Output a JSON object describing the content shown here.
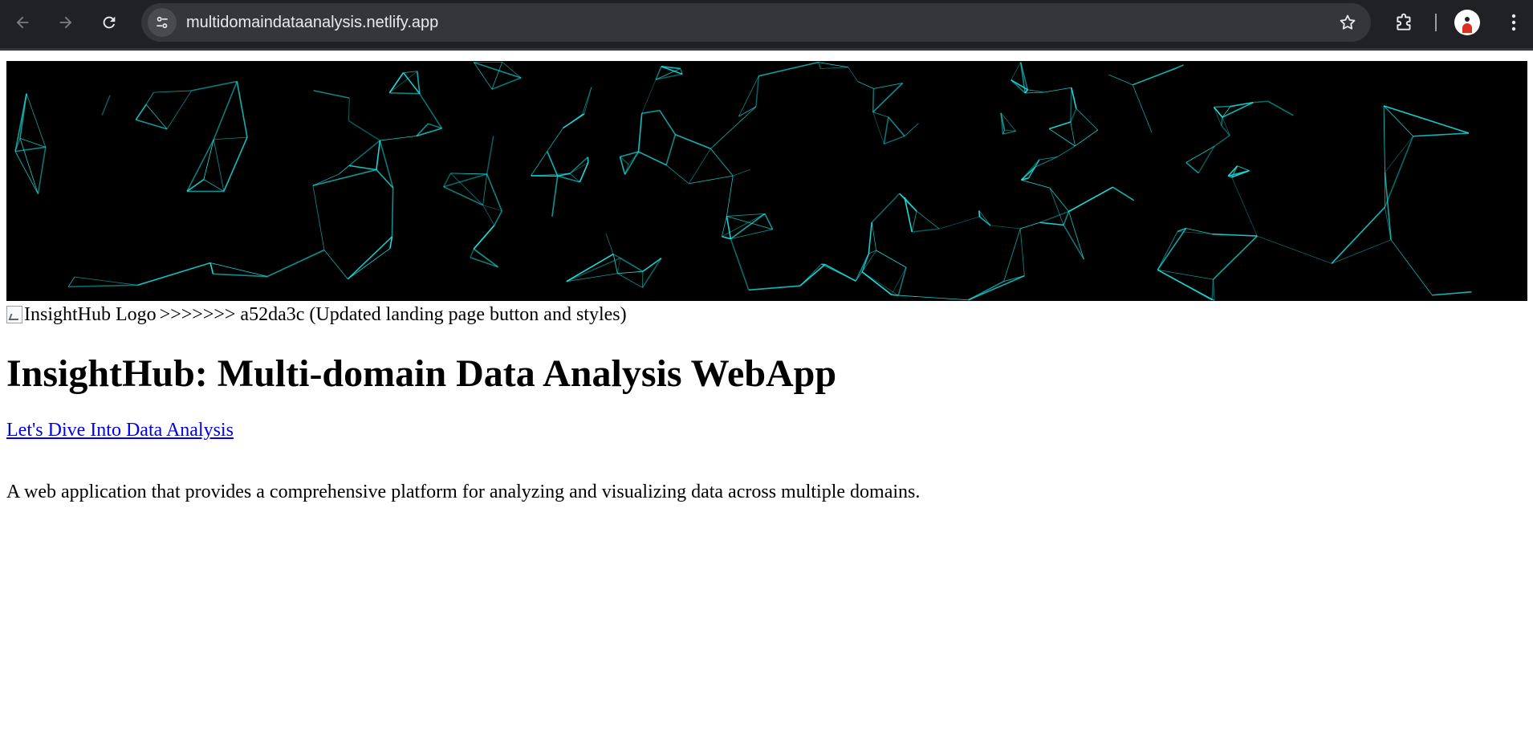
{
  "browser": {
    "url": "multidomaindataanalysis.netlify.app"
  },
  "page": {
    "logo_alt": "InsightHub Logo",
    "logo_line_text": ">>>>>>> a52da3c (Updated landing page button and styles)",
    "title": "InsightHub: Multi-domain Data Analysis WebApp",
    "cta_link": "Let's Dive Into Data Analysis",
    "description": "A web application that provides a comprehensive platform for analyzing and visualizing data across multiple domains."
  },
  "colors": {
    "chrome_bg": "#202124",
    "omnibox_bg": "#35363a",
    "banner_bg": "#000000",
    "banner_lines": "#19e6e6",
    "link": "#0000ee"
  }
}
